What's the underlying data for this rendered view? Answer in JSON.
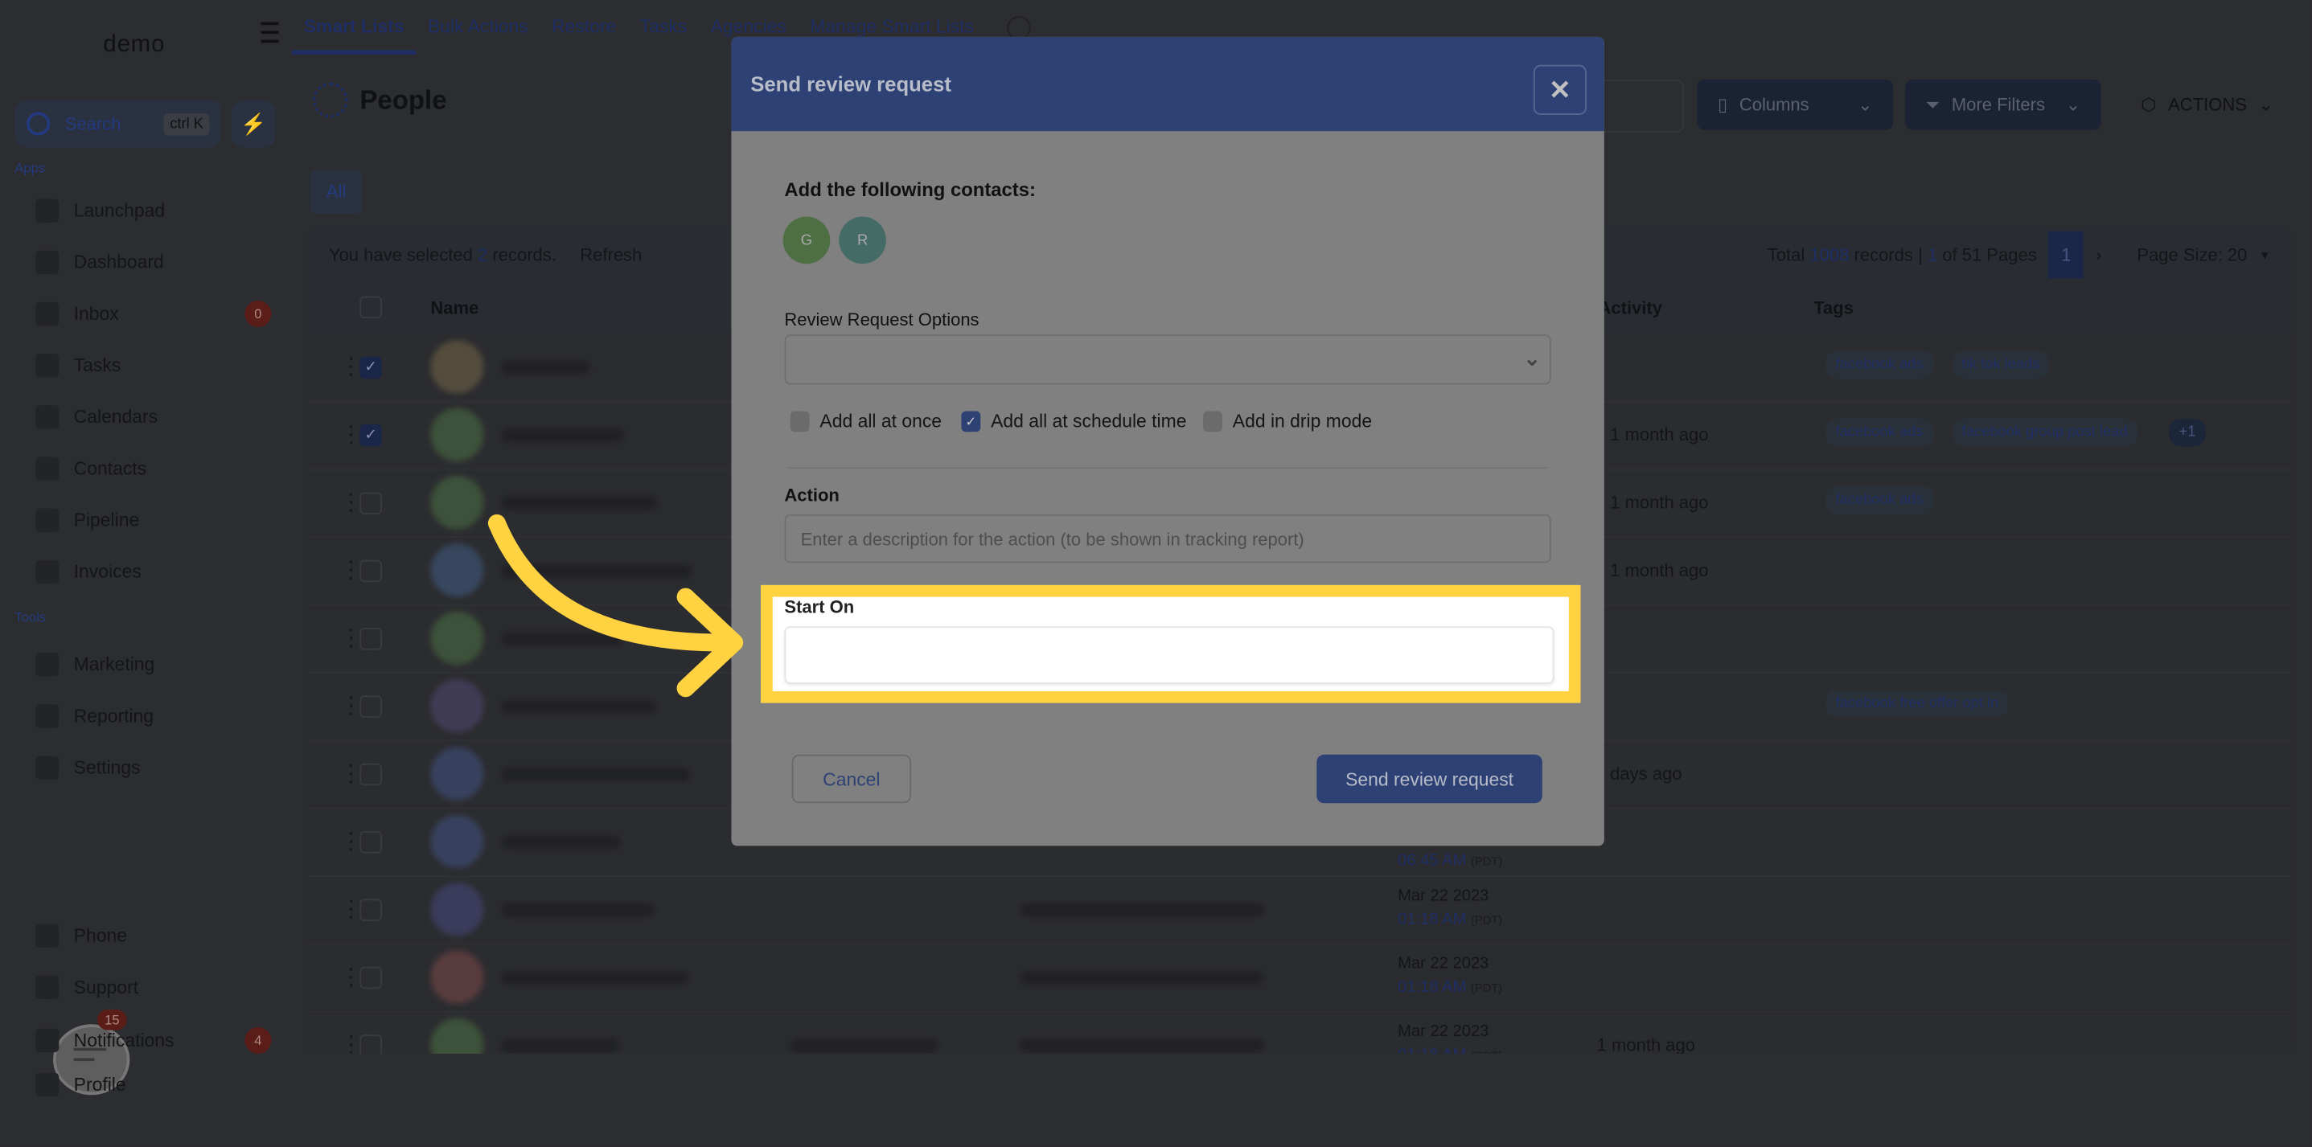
{
  "sidebar": {
    "logo": "demo",
    "search_label": "Search",
    "search_shortcut": "ctrl K",
    "apps_label": "Apps",
    "tools_label": "Tools",
    "items": [
      {
        "label": "Launchpad",
        "icon": "rocket-icon"
      },
      {
        "label": "Dashboard",
        "icon": "dashboard-icon"
      },
      {
        "label": "Inbox",
        "icon": "inbox-icon",
        "badge": "0"
      },
      {
        "label": "Tasks",
        "icon": "tasks-icon"
      },
      {
        "label": "Calendars",
        "icon": "calendar-icon"
      },
      {
        "label": "Contacts",
        "icon": "contacts-icon"
      },
      {
        "label": "Pipeline",
        "icon": "pipeline-icon"
      },
      {
        "label": "Invoices",
        "icon": "invoice-icon"
      }
    ],
    "tools": [
      {
        "label": "Marketing",
        "icon": "megaphone-icon"
      },
      {
        "label": "Reporting",
        "icon": "chart-icon"
      },
      {
        "label": "Settings",
        "icon": "settings-icon"
      }
    ],
    "bottom": [
      {
        "label": "Phone",
        "icon": "phone-icon"
      },
      {
        "label": "Support",
        "icon": "support-icon"
      },
      {
        "label": "Notifications",
        "icon": "bell-icon",
        "badge": "4"
      },
      {
        "label": "Profile",
        "icon": "avatar-icon"
      }
    ],
    "chat_badge": "15"
  },
  "topnav": {
    "tabs": [
      "Smart Lists",
      "Bulk Actions",
      "Restore",
      "Tasks",
      "Agencies",
      "Manage Smart Lists"
    ],
    "active": "Smart Lists"
  },
  "main": {
    "title": "People",
    "columns_label": "Columns",
    "filters_label": "More Filters",
    "actions_label": "ACTIONS",
    "all_tab": "All",
    "selection_prefix": "You have selected",
    "selection_count": "2",
    "selection_suffix": "records.",
    "refresh": "Refresh",
    "total_prefix": "Total",
    "total_records": "1008",
    "total_mid": "records |",
    "current_page": "1",
    "pages_suffix": "of 51 Pages",
    "page_size": "Page Size: 20",
    "headers": {
      "name": "Name",
      "activity": "Activity",
      "tags": "Tags"
    },
    "rows": [
      {
        "checked": true,
        "avatar": "#a08a5a",
        "activity": "",
        "tags": [
          "facebook ads",
          "tik tok leads"
        ]
      },
      {
        "checked": true,
        "avatar": "#5f9a4f",
        "activity": "1 month ago",
        "tags": [
          "facebook ads",
          "facebook group post lead"
        ],
        "more": "+1"
      },
      {
        "checked": false,
        "avatar": "#5f9a4f",
        "activity": "1 month ago",
        "tags": [
          "facebook ads"
        ]
      },
      {
        "checked": false,
        "avatar": "#4f7ab8",
        "activity": "1 month ago",
        "tags": []
      },
      {
        "checked": false,
        "avatar": "#5f9a4f",
        "activity": "",
        "tags": []
      },
      {
        "checked": false,
        "avatar": "#6a5aa0",
        "activity": "",
        "tags": [
          "facebook free offer opt in"
        ]
      },
      {
        "checked": false,
        "avatar": "#4f6ab8",
        "activity": "days ago",
        "tags": []
      },
      {
        "checked": false,
        "avatar": "#4f6ab8",
        "activity": "",
        "tags": [],
        "time": "06:45 AM",
        "tz": "(PDT)"
      },
      {
        "checked": false,
        "avatar": "#5a5ab0",
        "activity": "",
        "tags": [],
        "date": "Mar 22 2023",
        "time": "01:18 AM",
        "tz": "(PDT)",
        "email": true
      },
      {
        "checked": false,
        "avatar": "#b05a5a",
        "activity": "",
        "tags": [],
        "date": "Mar 22 2023",
        "time": "01:18 AM",
        "tz": "(PDT)",
        "email": true
      },
      {
        "checked": false,
        "avatar": "#5f9a4f",
        "activity": "1 month ago",
        "tags": [],
        "date": "Mar 22 2023",
        "time": "01:18 AM",
        "tz": "(PDT)",
        "email": true,
        "phone": true
      }
    ]
  },
  "modal": {
    "title": "Send review request",
    "contacts_label": "Add the following contacts:",
    "contacts": [
      {
        "initial": "G",
        "color": "#7cb867"
      },
      {
        "initial": "R",
        "color": "#5fa69c"
      }
    ],
    "options_label": "Review Request Options",
    "options_value": "",
    "modes": [
      {
        "label": "Add all at once",
        "checked": false
      },
      {
        "label": "Add all at schedule time",
        "checked": true
      },
      {
        "label": "Add in drip mode",
        "checked": false
      }
    ],
    "action_label": "Action",
    "action_placeholder": "Enter a description for the action (to be shown in tracking report)",
    "start_label": "Start On",
    "start_value": "",
    "cancel": "Cancel",
    "submit": "Send review request"
  },
  "colors": {
    "accent": "#3d5bd1",
    "modal_header": "#5a80e8",
    "highlight": "#ffd242"
  }
}
